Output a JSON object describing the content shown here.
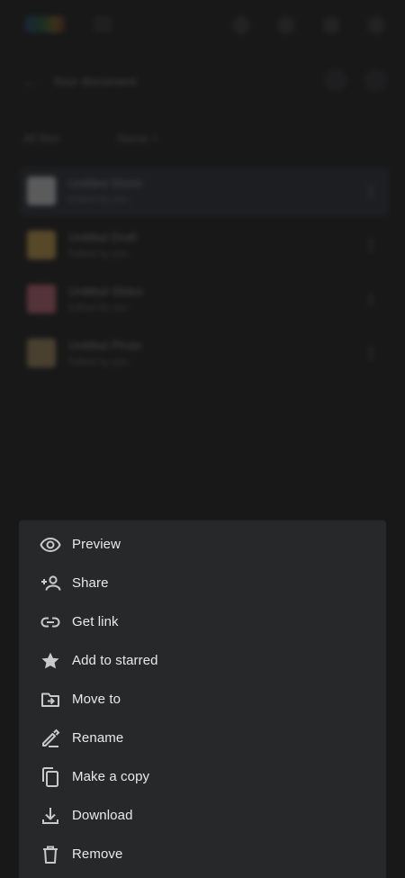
{
  "background": {
    "breadcrumb": "Your document",
    "filter_label": "All files",
    "sort_label": "Name",
    "files": [
      {
        "name": "Untitled Sheet",
        "meta": "Edited by you",
        "selected": true,
        "thumb_color": "#d7d7d7"
      },
      {
        "name": "Untitled Draft",
        "meta": "Edited by you",
        "selected": false,
        "thumb_color": "#c9a24a"
      },
      {
        "name": "Untitled Slides",
        "meta": "Edited by you",
        "selected": false,
        "thumb_color": "#c5677a"
      },
      {
        "name": "Untitled Photo",
        "meta": "Edited by you",
        "selected": false,
        "thumb_color": "#a48a5e"
      }
    ]
  },
  "menu": {
    "items": [
      {
        "label": "Preview",
        "icon": "eye-icon"
      },
      {
        "label": "Share",
        "icon": "person-add-icon"
      },
      {
        "label": "Get link",
        "icon": "link-icon"
      },
      {
        "label": "Add to starred",
        "icon": "star-icon"
      },
      {
        "label": "Move to",
        "icon": "folder-move-icon"
      },
      {
        "label": "Rename",
        "icon": "pencil-icon"
      },
      {
        "label": "Make a copy",
        "icon": "copy-icon"
      },
      {
        "label": "Download",
        "icon": "download-icon"
      },
      {
        "label": "Remove",
        "icon": "trash-icon"
      }
    ]
  },
  "colors": {
    "sheet_bg": "#27282a",
    "page_bg": "#1b1b1c",
    "menu_text": "#e9e9ea",
    "icon": "#c8c9cb"
  }
}
